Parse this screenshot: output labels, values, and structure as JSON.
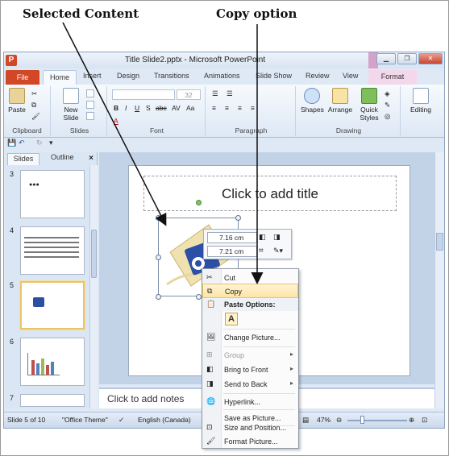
{
  "annotations": {
    "selected_content": "Selected Content",
    "copy_option": "Copy option"
  },
  "window": {
    "title": "Title Slide2.pptx - Microsoft PowerPoint",
    "app_icon": "P"
  },
  "ribbon_tabs": [
    "File",
    "Home",
    "Insert",
    "Design",
    "Transitions",
    "Animations",
    "Slide Show",
    "Review",
    "View",
    "Format"
  ],
  "ribbon": {
    "clipboard": {
      "label": "Clipboard",
      "paste": "Paste"
    },
    "slides": {
      "label": "Slides",
      "new_slide": "New",
      "new_slide2": "Slide"
    },
    "font": {
      "label": "Font",
      "size": "32",
      "bold": "B",
      "italic": "I",
      "underline": "U",
      "strike": "S",
      "abc": "abc",
      "av": "AV",
      "aa": "Aa",
      "font_color": "A"
    },
    "paragraph": {
      "label": "Paragraph"
    },
    "drawing": {
      "label": "Drawing",
      "shapes": "Shapes",
      "arrange": "Arrange",
      "quick": "Quick",
      "styles": "Styles"
    },
    "editing": {
      "label": "Editing"
    }
  },
  "left_pane": {
    "tab_slides": "Slides",
    "tab_outline": "Outline",
    "close": "×",
    "thumbnails": [
      "3",
      "4",
      "5",
      "6",
      "7"
    ]
  },
  "slide": {
    "title_placeholder": "Click to add title"
  },
  "notes": {
    "placeholder": "Click to add notes"
  },
  "mini_toolbar": {
    "height": "7.16 cm",
    "width": "7.21 cm"
  },
  "context_menu": {
    "cut": "Cut",
    "copy": "Copy",
    "paste_options": "Paste Options:",
    "paste_opt_glyph": "A",
    "change_picture": "Change Picture...",
    "group": "Group",
    "bring_to_front": "Bring to Front",
    "send_to_back": "Send to Back",
    "hyperlink": "Hyperlink...",
    "save_as_picture": "Save as Picture...",
    "size_position": "Size and Position...",
    "format_picture": "Format Picture..."
  },
  "status_bar": {
    "slide": "Slide 5 of 10",
    "theme": "\"Office Theme\"",
    "language": "English (Canada)",
    "zoom": "47%"
  },
  "colors": {
    "file_tab": "#d24726",
    "format_tab": "#f3d8ec",
    "menu_highlight": "#fde5a4"
  }
}
